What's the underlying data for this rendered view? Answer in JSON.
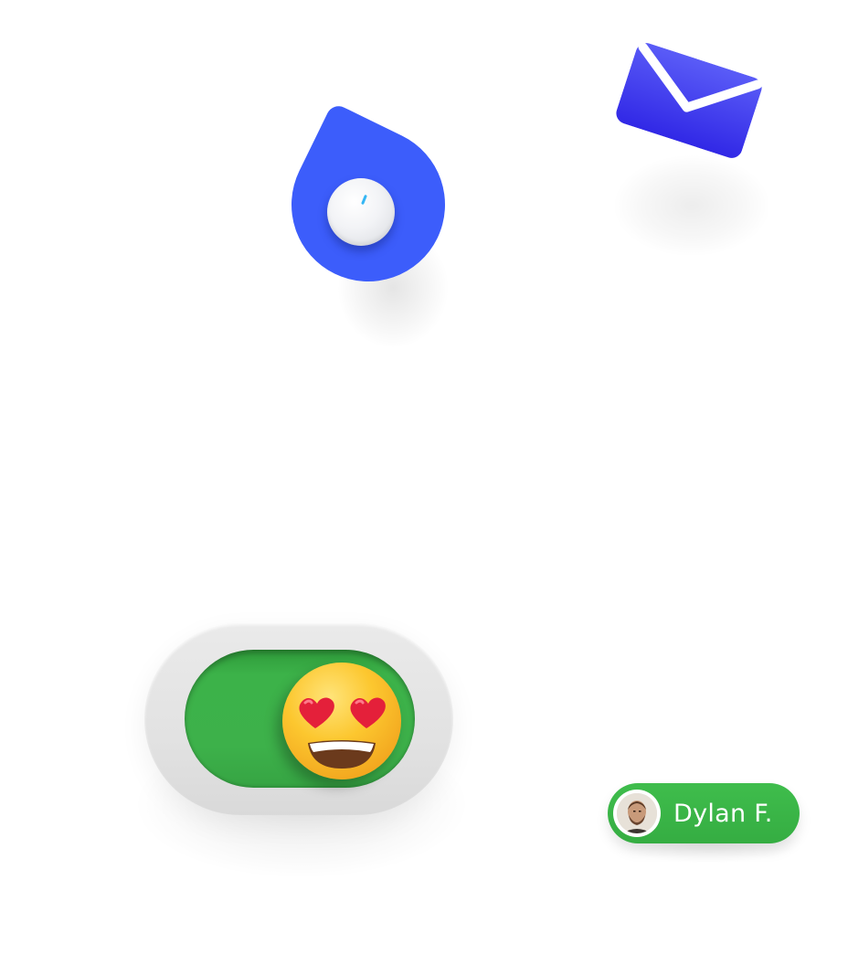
{
  "colors": {
    "drop_blue": "#3c5dfb",
    "mail_blue": "#3b3ff0",
    "toggle_green": "#3db14a",
    "toggle_frame": "#e2e2e2",
    "chip_green": "#3fbd4c",
    "knob_tick": "#35b6f4"
  },
  "icons": {
    "drop": "water-drop-icon",
    "knob": "dial-knob",
    "mail": "envelope-icon",
    "toggle_thumb": "heart-eyes-emoji",
    "avatar": "user-avatar-photo"
  },
  "toggle": {
    "state": "on"
  },
  "user_chip": {
    "name": "Dylan F."
  }
}
